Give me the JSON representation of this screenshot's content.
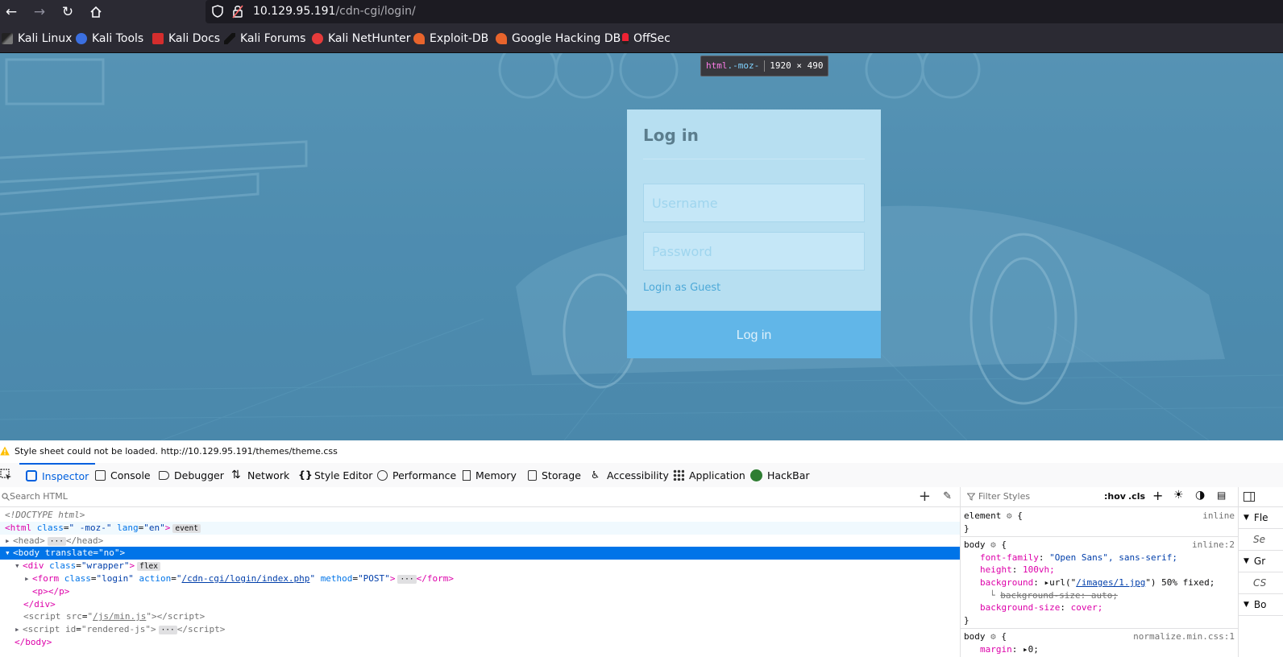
{
  "browser": {
    "url_host": "10.129.95.191",
    "url_path": "/cdn-cgi/login/",
    "bookmarks": [
      "Kali Linux",
      "Kali Tools",
      "Kali Docs",
      "Kali Forums",
      "Kali NetHunter",
      "Exploit-DB",
      "Google Hacking DB",
      "OffSec"
    ]
  },
  "highlight_tooltip": {
    "tag": "html",
    "cls": ".-moz-",
    "size": "1920 × 490"
  },
  "login": {
    "title": "Log in",
    "username_placeholder": "Username",
    "password_placeholder": "Password",
    "guest_link": "Login as Guest",
    "submit_label": "Log in"
  },
  "console_message": "Style sheet could not be loaded. http://10.129.95.191/themes/theme.css",
  "devtools": {
    "tabs": [
      "Inspector",
      "Console",
      "Debugger",
      "Network",
      "Style Editor",
      "Performance",
      "Memory",
      "Storage",
      "Accessibility",
      "Application",
      "HackBar"
    ],
    "active_tab": "Inspector",
    "search_placeholder": "Search HTML",
    "filter_placeholder": "Filter Styles",
    "rules_tools": [
      ":hov",
      ".cls"
    ],
    "html_lines": {
      "doctype": "<!DOCTYPE html>",
      "html_class": "\" -moz-\"",
      "html_lang": "\"en\"",
      "event_badge": "event",
      "flex_badge": "flex",
      "form_action": "/cdn-cgi/login/index.php",
      "form_method": "\"POST\"",
      "script_src": "/js/min.js",
      "script_id": "\"rendered-js\""
    },
    "rules": {
      "element_source": "inline",
      "body_source": "inline:2",
      "body_font_family": "\"Open Sans\", sans-serif;",
      "body_height": "100vh;",
      "body_bg_url": "/images/1.jpg",
      "body_bg_rest": "\") 50% fixed;",
      "body_bg_size_overridden": "background-size: auto;",
      "body_bg_size": "cover;",
      "normalize_source": "normalize.min.css:1",
      "normalize_margin": "0;"
    },
    "layout_sections": [
      "Fle",
      "Se",
      "Gr",
      "CS",
      "Bo"
    ]
  }
}
